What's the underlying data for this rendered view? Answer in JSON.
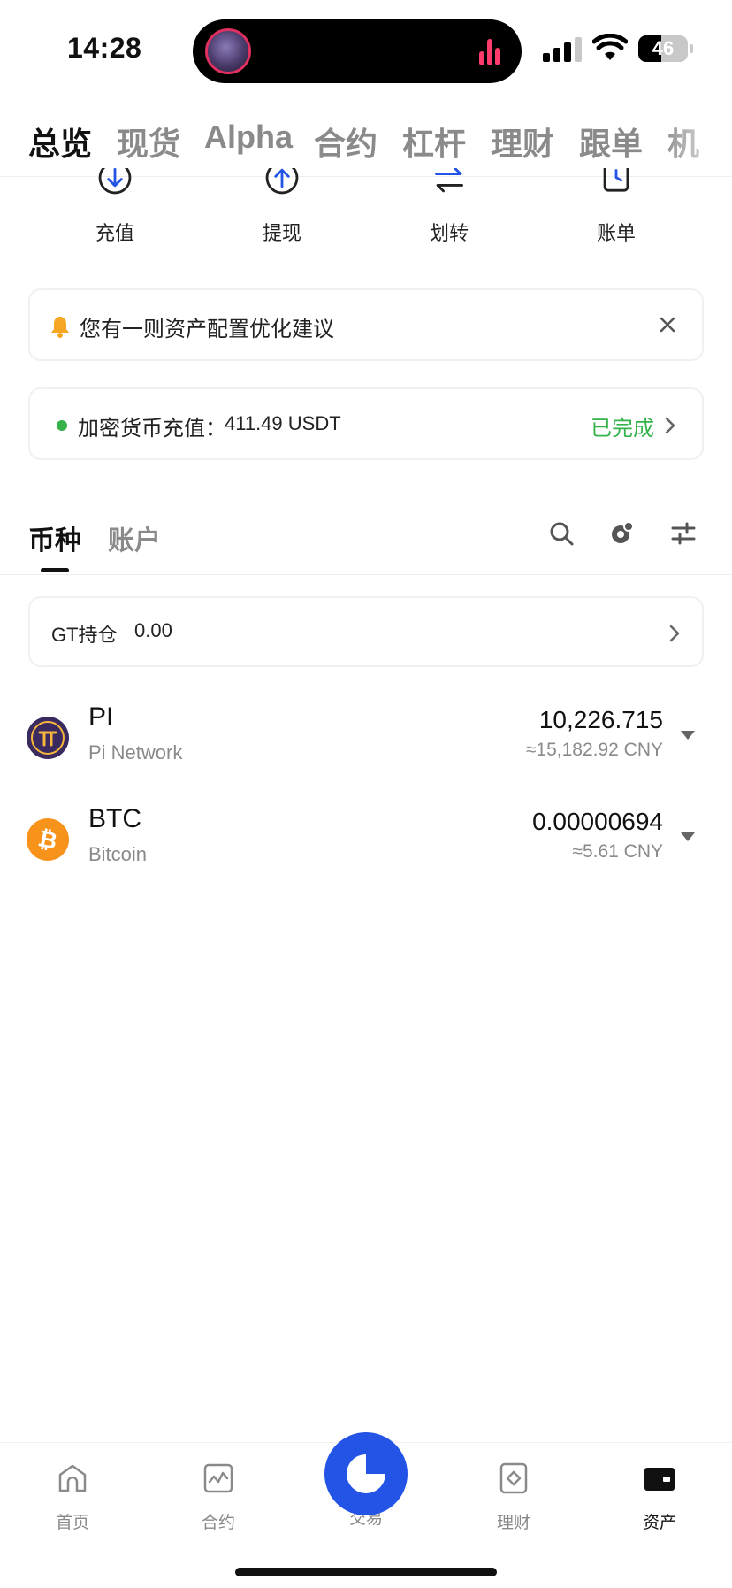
{
  "status_bar": {
    "time": "14:28",
    "battery": "46",
    "battery_level": 0.46
  },
  "top_tabs": [
    {
      "label": "总览",
      "active": true
    },
    {
      "label": "现货",
      "active": false
    },
    {
      "label": "Alpha",
      "active": false
    },
    {
      "label": "合约",
      "active": false
    },
    {
      "label": "杠杆",
      "active": false
    },
    {
      "label": "理财",
      "active": false
    },
    {
      "label": "跟单",
      "active": false
    },
    {
      "label": "机",
      "active": false
    }
  ],
  "actions": [
    {
      "label": "充值",
      "icon": "deposit-icon"
    },
    {
      "label": "提现",
      "icon": "withdraw-icon"
    },
    {
      "label": "划转",
      "icon": "transfer-icon"
    },
    {
      "label": "账单",
      "icon": "bill-icon"
    }
  ],
  "notice": {
    "text": "您有一则资产配置优化建议"
  },
  "deposit_notice": {
    "label": "加密货币充值：",
    "value": "411.49 USDT",
    "status": "已完成"
  },
  "section_tabs": [
    {
      "label": "币种",
      "active": true
    },
    {
      "label": "账户",
      "active": false
    }
  ],
  "gt_holding": {
    "label": "GT持仓",
    "value": "0.00"
  },
  "coins": [
    {
      "symbol": "PI",
      "name": "Pi Network",
      "amount": "10,226.715",
      "fiat": "≈15,182.92 CNY",
      "color": "#3a2a5f",
      "icon": "pi-network-icon"
    },
    {
      "symbol": "BTC",
      "name": "Bitcoin",
      "amount": "0.00000694",
      "fiat": "≈5.61 CNY",
      "color": "#f7931a",
      "icon": "bitcoin-icon"
    }
  ],
  "bottom_nav": [
    {
      "label": "首页",
      "icon": "home-icon",
      "active": false
    },
    {
      "label": "合约",
      "icon": "futures-icon",
      "active": false
    },
    {
      "label": "交易",
      "icon": "trade-icon",
      "active": false
    },
    {
      "label": "理财",
      "icon": "earn-icon",
      "active": false
    },
    {
      "label": "资产",
      "icon": "wallet-icon",
      "active": true
    }
  ],
  "colors": {
    "accent": "#2354e6",
    "success": "#35b34a",
    "notice_bell": "#f5a623",
    "pi_purple": "#3a2a5f",
    "bitcoin_orange": "#f7931a"
  }
}
